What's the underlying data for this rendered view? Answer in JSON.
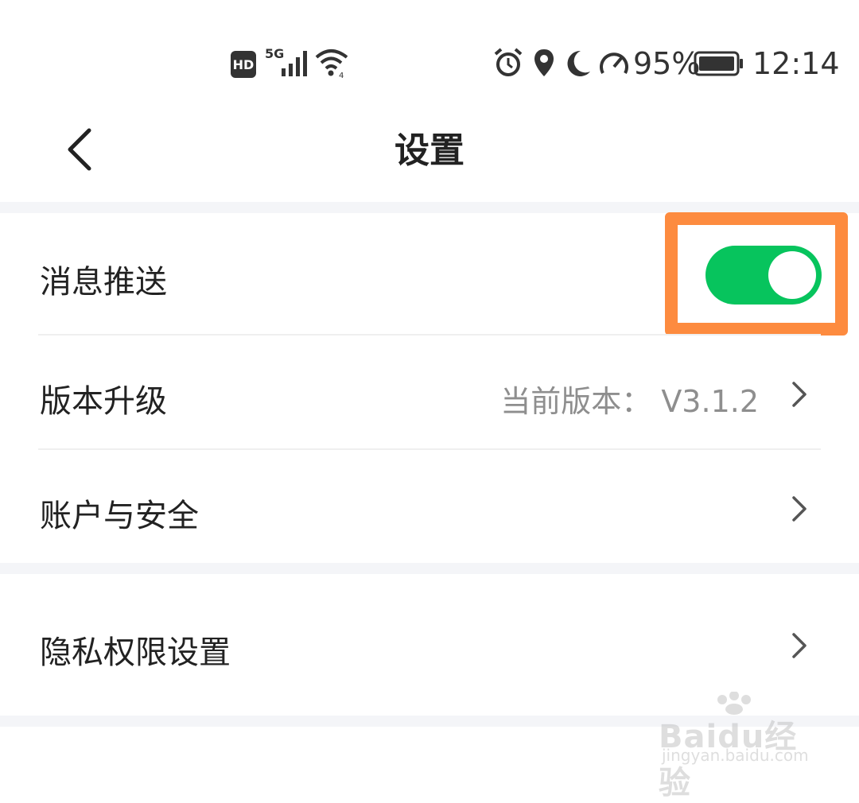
{
  "status_bar": {
    "hd": "HD",
    "network": "5G",
    "battery": "95%",
    "time": "12:14",
    "icons": [
      "hd-badge",
      "signal-icon",
      "wifi-icon",
      "alarm-icon",
      "location-icon",
      "moon-icon",
      "speed-icon",
      "battery-icon"
    ]
  },
  "header": {
    "title": "设置",
    "back_icon": "chevron-left-icon"
  },
  "settings": {
    "push": {
      "label": "消息推送",
      "toggle_on": true,
      "toggle_color": "#07c45d"
    },
    "upgrade": {
      "label": "版本升级",
      "value": "当前版本：  V3.1.2"
    },
    "account": {
      "label": "账户与安全"
    },
    "privacy": {
      "label": "隐私权限设置"
    }
  },
  "highlight_color": "#fd8b3f",
  "watermark": {
    "brand": "Baidu经验",
    "url": "jingyan.baidu.com"
  }
}
